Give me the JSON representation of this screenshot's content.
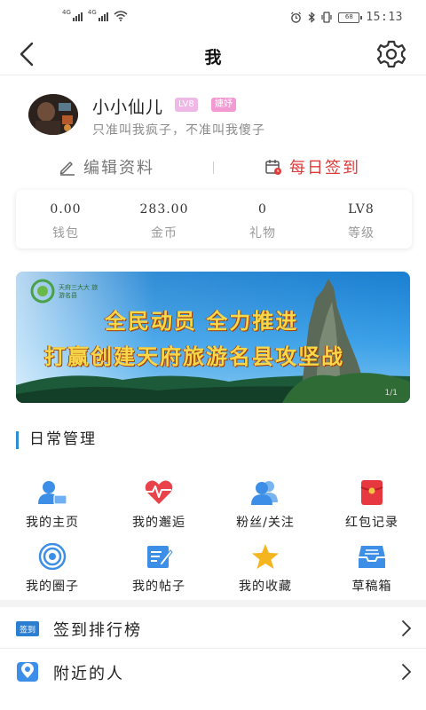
{
  "status_bar": {
    "signal1_label": "4G",
    "signal2_label": "4G",
    "battery": "68",
    "time": "15:13"
  },
  "nav": {
    "title": "我"
  },
  "profile": {
    "username": "小小仙儿",
    "level_badge": "LV8",
    "tag_badge": "婕妤",
    "signature": "只准叫我疯子，不准叫我傻子"
  },
  "actions": {
    "edit_label": "编辑资料",
    "checkin_label": "每日签到"
  },
  "stats": [
    {
      "value": "0.00",
      "label": "钱包"
    },
    {
      "value": "283.00",
      "label": "金币"
    },
    {
      "value": "0",
      "label": "礼物"
    },
    {
      "value": "LV8",
      "label": "等级"
    }
  ],
  "banner": {
    "logo_text": "天府三大大 旅游名县",
    "line1": "全民动员 全力推进",
    "line2": "打赢创建天府旅游名县攻坚战",
    "pager": "1/1"
  },
  "section": {
    "title": "日常管理"
  },
  "grid": [
    {
      "label": "我的主页",
      "icon": "person-card-icon"
    },
    {
      "label": "我的邂逅",
      "icon": "heartbeat-icon"
    },
    {
      "label": "粉丝/关注",
      "icon": "users-icon"
    },
    {
      "label": "红包记录",
      "icon": "red-envelope-icon"
    },
    {
      "label": "我的圈子",
      "icon": "target-circle-icon"
    },
    {
      "label": "我的帖子",
      "icon": "post-edit-icon"
    },
    {
      "label": "我的收藏",
      "icon": "star-icon"
    },
    {
      "label": "草稿箱",
      "icon": "inbox-tray-icon"
    }
  ],
  "list": [
    {
      "label": "签到排行榜",
      "icon_text": "签到"
    },
    {
      "label": "附近的人"
    }
  ],
  "colors": {
    "accent_blue": "#2c8fd4",
    "checkin_red": "#e03a3a",
    "badge_pink": "#f39ad2"
  }
}
